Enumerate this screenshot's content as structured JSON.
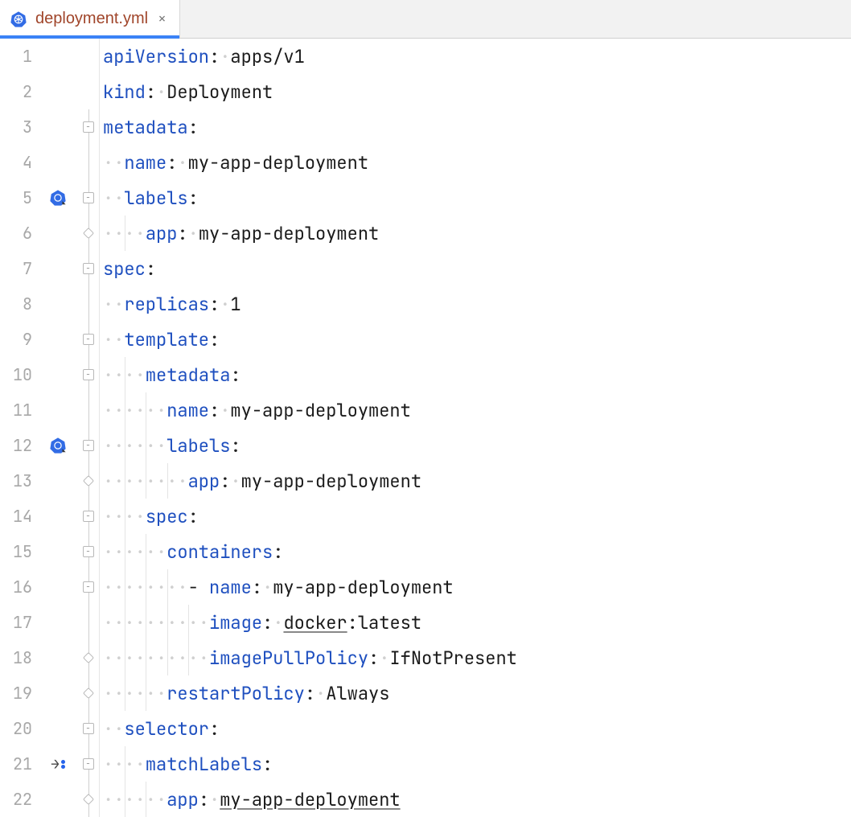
{
  "tab": {
    "filename": "deployment.yml",
    "icon": "kubernetes-icon"
  },
  "lines": [
    {
      "n": 1,
      "fold": "",
      "icons": [],
      "guides": [],
      "tokens": [
        [
          "key",
          "apiVersion"
        ],
        [
          "colon",
          ":"
        ],
        [
          "ws",
          " "
        ],
        [
          "val",
          "apps/v1"
        ]
      ]
    },
    {
      "n": 2,
      "fold": "",
      "icons": [],
      "guides": [],
      "tokens": [
        [
          "key",
          "kind"
        ],
        [
          "colon",
          ":"
        ],
        [
          "ws",
          " "
        ],
        [
          "val",
          "Deployment"
        ]
      ]
    },
    {
      "n": 3,
      "fold": "open",
      "icons": [],
      "guides": [],
      "tokens": [
        [
          "key",
          "metadata"
        ],
        [
          "colon",
          ":"
        ]
      ]
    },
    {
      "n": 4,
      "fold": "line",
      "icons": [],
      "guides": [],
      "tokens": [
        [
          "ws",
          "  "
        ],
        [
          "key",
          "name"
        ],
        [
          "colon",
          ":"
        ],
        [
          "ws",
          " "
        ],
        [
          "val",
          "my-app-deployment"
        ]
      ]
    },
    {
      "n": 5,
      "fold": "open",
      "icons": [
        "k8s"
      ],
      "guides": [],
      "tokens": [
        [
          "ws",
          "  "
        ],
        [
          "key",
          "labels"
        ],
        [
          "colon",
          ":"
        ]
      ]
    },
    {
      "n": 6,
      "fold": "close",
      "icons": [],
      "guides": [
        1
      ],
      "tokens": [
        [
          "ws",
          "    "
        ],
        [
          "key",
          "app"
        ],
        [
          "colon",
          ":"
        ],
        [
          "ws",
          " "
        ],
        [
          "val",
          "my-app-deployment"
        ]
      ]
    },
    {
      "n": 7,
      "fold": "open",
      "icons": [],
      "guides": [],
      "tokens": [
        [
          "key",
          "spec"
        ],
        [
          "colon",
          ":"
        ]
      ]
    },
    {
      "n": 8,
      "fold": "line",
      "icons": [],
      "guides": [],
      "tokens": [
        [
          "ws",
          "  "
        ],
        [
          "key",
          "replicas"
        ],
        [
          "colon",
          ":"
        ],
        [
          "ws",
          " "
        ],
        [
          "val",
          "1"
        ]
      ]
    },
    {
      "n": 9,
      "fold": "open",
      "icons": [],
      "guides": [],
      "tokens": [
        [
          "ws",
          "  "
        ],
        [
          "key",
          "template"
        ],
        [
          "colon",
          ":"
        ]
      ]
    },
    {
      "n": 10,
      "fold": "open",
      "icons": [],
      "guides": [
        1
      ],
      "tokens": [
        [
          "ws",
          "    "
        ],
        [
          "key",
          "metadata"
        ],
        [
          "colon",
          ":"
        ]
      ]
    },
    {
      "n": 11,
      "fold": "line",
      "icons": [],
      "guides": [
        1,
        2
      ],
      "tokens": [
        [
          "ws",
          "      "
        ],
        [
          "key",
          "name"
        ],
        [
          "colon",
          ":"
        ],
        [
          "ws",
          " "
        ],
        [
          "val",
          "my-app-deployment"
        ]
      ]
    },
    {
      "n": 12,
      "fold": "open",
      "icons": [
        "k8s"
      ],
      "guides": [
        1,
        2
      ],
      "tokens": [
        [
          "ws",
          "      "
        ],
        [
          "key",
          "labels"
        ],
        [
          "colon",
          ":"
        ]
      ]
    },
    {
      "n": 13,
      "fold": "close",
      "icons": [],
      "guides": [
        1,
        2,
        3
      ],
      "tokens": [
        [
          "ws",
          "        "
        ],
        [
          "key",
          "app"
        ],
        [
          "colon",
          ":"
        ],
        [
          "ws",
          " "
        ],
        [
          "val",
          "my-app-deployment"
        ]
      ]
    },
    {
      "n": 14,
      "fold": "open",
      "icons": [],
      "guides": [
        1
      ],
      "tokens": [
        [
          "ws",
          "    "
        ],
        [
          "key",
          "spec"
        ],
        [
          "colon",
          ":"
        ]
      ]
    },
    {
      "n": 15,
      "fold": "open",
      "icons": [],
      "guides": [
        1,
        2
      ],
      "tokens": [
        [
          "ws",
          "      "
        ],
        [
          "key",
          "containers"
        ],
        [
          "colon",
          ":"
        ]
      ]
    },
    {
      "n": 16,
      "fold": "open",
      "icons": [],
      "guides": [
        1,
        2,
        3
      ],
      "tokens": [
        [
          "ws",
          "        "
        ],
        [
          "val",
          "- "
        ],
        [
          "key",
          "name"
        ],
        [
          "colon",
          ":"
        ],
        [
          "ws",
          " "
        ],
        [
          "val",
          "my-app-deployment"
        ]
      ]
    },
    {
      "n": 17,
      "fold": "line",
      "icons": [],
      "guides": [
        1,
        2,
        3,
        4
      ],
      "tokens": [
        [
          "ws",
          "          "
        ],
        [
          "key",
          "image"
        ],
        [
          "colon",
          ":"
        ],
        [
          "ws",
          " "
        ],
        [
          "valU",
          "docker"
        ],
        [
          "val",
          ":latest"
        ]
      ]
    },
    {
      "n": 18,
      "fold": "close",
      "icons": [],
      "guides": [
        1,
        2,
        3,
        4
      ],
      "tokens": [
        [
          "ws",
          "          "
        ],
        [
          "key",
          "imagePullPolicy"
        ],
        [
          "colon",
          ":"
        ],
        [
          "ws",
          " "
        ],
        [
          "val",
          "IfNotPresent"
        ]
      ]
    },
    {
      "n": 19,
      "fold": "close",
      "icons": [],
      "guides": [
        1,
        2
      ],
      "tokens": [
        [
          "ws",
          "      "
        ],
        [
          "key",
          "restartPolicy"
        ],
        [
          "colon",
          ":"
        ],
        [
          "ws",
          " "
        ],
        [
          "val",
          "Always"
        ]
      ]
    },
    {
      "n": 20,
      "fold": "open",
      "icons": [],
      "guides": [],
      "tokens": [
        [
          "ws",
          "  "
        ],
        [
          "key",
          "selector"
        ],
        [
          "colon",
          ":"
        ]
      ]
    },
    {
      "n": 21,
      "fold": "open",
      "icons": [
        "bp"
      ],
      "guides": [
        1
      ],
      "tokens": [
        [
          "ws",
          "    "
        ],
        [
          "key",
          "matchLabels"
        ],
        [
          "colon",
          ":"
        ]
      ]
    },
    {
      "n": 22,
      "fold": "close",
      "icons": [],
      "guides": [
        1,
        2
      ],
      "tokens": [
        [
          "ws",
          "      "
        ],
        [
          "key",
          "app"
        ],
        [
          "colon",
          ":"
        ],
        [
          "ws",
          " "
        ],
        [
          "valU",
          "my-app-deployment"
        ]
      ]
    }
  ]
}
